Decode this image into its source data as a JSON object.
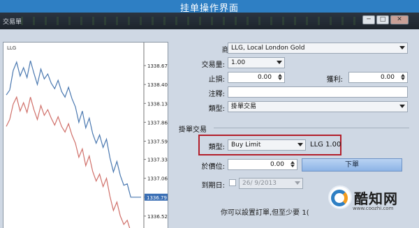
{
  "page_heading": "挂单操作界面",
  "window": {
    "title": "交易單",
    "buttons": {
      "minimize": "─",
      "maximize": "□",
      "close": "✕"
    }
  },
  "chart": {
    "symbol": "LLG",
    "current_price_blue": "1336.79",
    "current_price_red": "1336.25"
  },
  "chart_data": {
    "type": "line",
    "ylim": [
      1336.25,
      1338.9
    ],
    "y_ticks": [
      "1338.67",
      "1338.40",
      "1338.13",
      "1337.86",
      "1337.59",
      "1337.33",
      "1337.06",
      "1336.79",
      "1336.52",
      "1336.25"
    ],
    "series": [
      {
        "color": "#4a78b0",
        "values": [
          1338.25,
          1338.32,
          1338.6,
          1338.72,
          1338.52,
          1338.64,
          1338.5,
          1338.74,
          1338.56,
          1338.4,
          1338.62,
          1338.48,
          1338.55,
          1338.42,
          1338.34,
          1338.46,
          1338.3,
          1338.22,
          1338.36,
          1338.2,
          1338.08,
          1337.86,
          1338.02,
          1337.78,
          1337.92,
          1337.7,
          1337.56,
          1337.68,
          1337.5,
          1337.62,
          1337.35,
          1337.15,
          1337.3,
          1337.1,
          1336.96,
          1336.98,
          1336.79,
          1336.79,
          1336.79,
          1336.79
        ]
      },
      {
        "color": "#d0706a",
        "values": [
          1337.8,
          1337.9,
          1338.12,
          1338.22,
          1338.02,
          1338.14,
          1338.0,
          1338.22,
          1338.04,
          1337.9,
          1338.1,
          1337.96,
          1338.04,
          1337.92,
          1337.82,
          1337.94,
          1337.8,
          1337.72,
          1337.84,
          1337.68,
          1337.56,
          1337.36,
          1337.48,
          1337.24,
          1337.38,
          1337.16,
          1337.02,
          1337.12,
          1336.94,
          1337.06,
          1336.8,
          1336.6,
          1336.72,
          1336.52,
          1336.4,
          1336.46,
          1336.3,
          1336.25,
          1336.25,
          1336.25
        ]
      }
    ]
  },
  "form": {
    "symbol_label": "商品:",
    "symbol_value": "LLG, Local London Gold",
    "volume_label": "交易量:",
    "volume_value": "1.00",
    "stoploss_label": "止損:",
    "stoploss_value": "0.00",
    "takeprofit_label": "獲利:",
    "takeprofit_value": "0.00",
    "comment_label": "注釋:",
    "comment_value": "",
    "type_label": "類型:",
    "type_value": "掛單交易",
    "pending_section": "掛單交易",
    "pending_type_label": "類型:",
    "pending_type_value": "Buy Limit",
    "pending_symbol_info": "LLG 1.00",
    "price_label": "於價位:",
    "price_value": "0.00",
    "place_button": "下單",
    "expiry_label": "到期日:",
    "expiry_value": "26/ 9/2013",
    "note": "你可以設置訂單,但至少要 1("
  },
  "watermark": {
    "brand": "酷知网",
    "url": "www.coozhi.com"
  }
}
